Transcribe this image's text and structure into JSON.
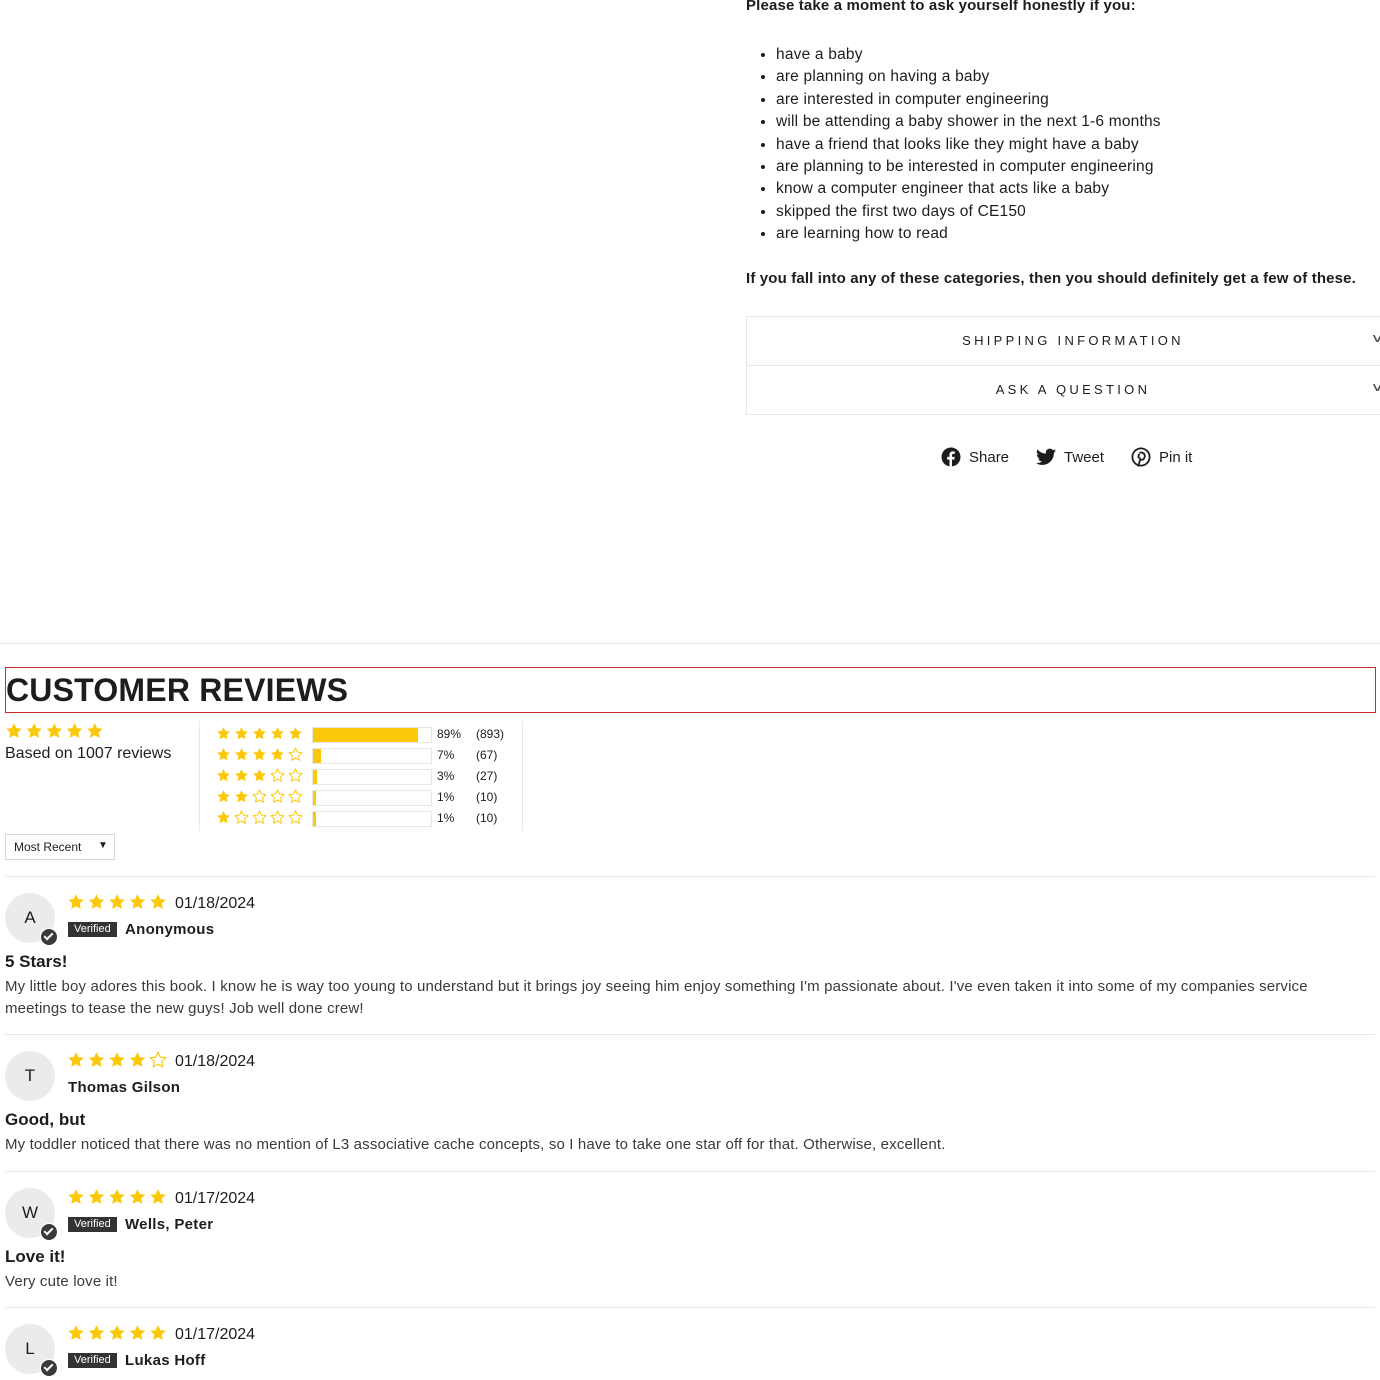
{
  "description": {
    "intro": "Please take a moment to ask yourself honestly if you:",
    "items": [
      "have a baby",
      "are planning on having a baby",
      "are interested in computer engineering",
      "will be attending a baby shower in the next 1-6 months",
      "have a friend that looks like they might have a baby",
      "are planning to be interested in computer engineering",
      "know a computer engineer that acts like a baby",
      "skipped the first two days of CE150",
      "are learning how to read"
    ],
    "outro": "If you fall into any of these categories, then you should definitely get a few of these."
  },
  "accordion": {
    "shipping": "SHIPPING INFORMATION",
    "ask": "ASK A QUESTION"
  },
  "share": {
    "facebook": "Share",
    "twitter": "Tweet",
    "pinterest": "Pin it"
  },
  "reviews": {
    "title": "CUSTOMER REVIEWS",
    "average_rating": 5,
    "based_on": "Based on 1007 reviews",
    "histogram": [
      {
        "stars": 5,
        "percent": "89%",
        "count": "(893)",
        "fraction": 0.89
      },
      {
        "stars": 4,
        "percent": "7%",
        "count": "(67)",
        "fraction": 0.07
      },
      {
        "stars": 3,
        "percent": "3%",
        "count": "(27)",
        "fraction": 0.03
      },
      {
        "stars": 2,
        "percent": "1%",
        "count": "(10)",
        "fraction": 0.01
      },
      {
        "stars": 1,
        "percent": "1%",
        "count": "(10)",
        "fraction": 0.01
      }
    ],
    "sort_label": "Most Recent",
    "verified_label": "Verified",
    "items": [
      {
        "initial": "A",
        "rating": 5,
        "date": "01/18/2024",
        "verified": true,
        "author": "Anonymous",
        "title": "5 Stars!",
        "body": "My little boy adores this book. I know he is way too young to understand but it brings joy seeing him enjoy something I'm passionate about. I've even taken it into some of my companies service meetings to tease the new guys! Job well done crew!"
      },
      {
        "initial": "T",
        "rating": 4,
        "date": "01/18/2024",
        "verified": false,
        "author": "Thomas Gilson",
        "title": "Good, but",
        "body": "My toddler noticed that there was no mention of L3 associative cache concepts, so I have to take one star off for that. Otherwise, excellent."
      },
      {
        "initial": "W",
        "rating": 5,
        "date": "01/17/2024",
        "verified": true,
        "author": "Wells, Peter",
        "title": "Love it!",
        "body": "Very cute love it!"
      },
      {
        "initial": "L",
        "rating": 5,
        "date": "01/17/2024",
        "verified": true,
        "author": "Lukas Hoff",
        "title": "",
        "body": ""
      }
    ]
  },
  "colors": {
    "star": "#fcc80c",
    "text": "#1c1d1d",
    "border": "#e8e8e1",
    "highlight_border": "#cc2c2c",
    "badge": "#333333"
  },
  "icons": {
    "facebook": "facebook-icon",
    "twitter": "twitter-icon",
    "pinterest": "pinterest-icon",
    "chevron": "chevron-down-icon",
    "star_filled": "star-filled-icon",
    "star_empty": "star-empty-icon",
    "verified": "verified-check-icon"
  }
}
